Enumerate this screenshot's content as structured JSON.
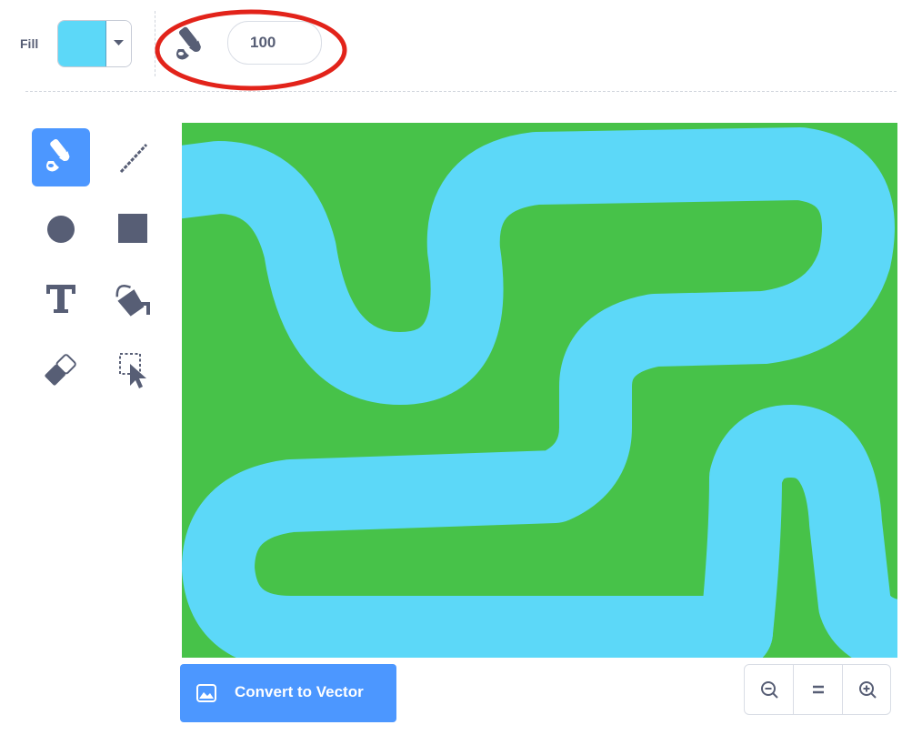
{
  "toolbar": {
    "fill_label": "Fill",
    "fill_color": "#5cd8f8",
    "brush_size": "100",
    "brush_size_icon": "brush-icon",
    "highlight_color": "#e2231a"
  },
  "tools": [
    {
      "name": "brush",
      "icon": "brush-icon",
      "selected": true
    },
    {
      "name": "line",
      "icon": "line-icon",
      "selected": false
    },
    {
      "name": "circle",
      "icon": "circle-icon",
      "selected": false
    },
    {
      "name": "rectangle",
      "icon": "rectangle-icon",
      "selected": false
    },
    {
      "name": "text",
      "icon": "text-icon",
      "selected": false
    },
    {
      "name": "fill",
      "icon": "fill-bucket-icon",
      "selected": false
    },
    {
      "name": "eraser",
      "icon": "eraser-icon",
      "selected": false
    },
    {
      "name": "select",
      "icon": "select-icon",
      "selected": false
    }
  ],
  "canvas": {
    "background_color": "#47c249",
    "path_color": "#5cd8f8"
  },
  "convert_button": {
    "label": "Convert to Vector",
    "icon": "image-icon"
  },
  "zoom": {
    "zoom_out_icon": "zoom-out-icon",
    "reset_icon": "zoom-reset-icon",
    "zoom_in_icon": "zoom-in-icon"
  },
  "colors": {
    "accent": "#4c97ff",
    "text": "#575e75",
    "tool_icon": "#575e75"
  }
}
